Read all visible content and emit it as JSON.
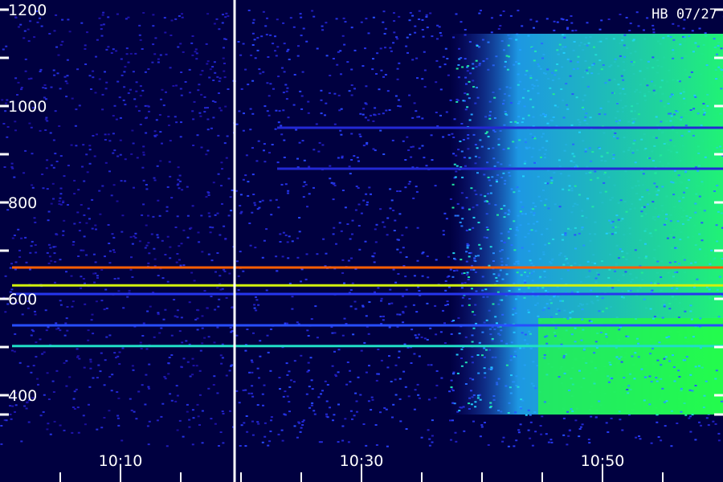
{
  "station_label": "HB 07/27",
  "chart_data": {
    "type": "heatmap",
    "title": "",
    "xlabel": "",
    "ylabel": "",
    "ylim": [
      350,
      1210
    ],
    "y_ticks": [
      1200,
      1000,
      800,
      600,
      400
    ],
    "y_minor_ticks": [
      1100,
      900,
      700,
      500,
      360
    ],
    "x_time_range": [
      "10:00",
      "11:00"
    ],
    "x_ticks": [
      "10:10",
      "10:30",
      "10:50"
    ],
    "gap_marker_time": "10:19",
    "colormap": [
      "#000040",
      "#1e10a8",
      "#2840ff",
      "#20d0ff",
      "#20ff40",
      "#ffee00",
      "#ff2000"
    ],
    "event": {
      "start": "10:40",
      "peak": "10:52",
      "freq_range": [
        360,
        1150
      ],
      "peak_intensity": 0.62
    },
    "emission_lines": [
      {
        "freq": 665,
        "start": "10:01",
        "intensity": 0.95
      },
      {
        "freq": 628,
        "start": "10:01",
        "intensity": 0.8
      },
      {
        "freq": 610,
        "start": "10:01",
        "intensity": 0.3
      },
      {
        "freq": 545,
        "start": "10:01",
        "intensity": 0.35
      },
      {
        "freq": 502,
        "start": "10:01",
        "intensity": 0.55
      },
      {
        "freq": 955,
        "start": "10:23",
        "intensity": 0.25
      },
      {
        "freq": 870,
        "start": "10:23",
        "intensity": 0.25
      }
    ]
  }
}
